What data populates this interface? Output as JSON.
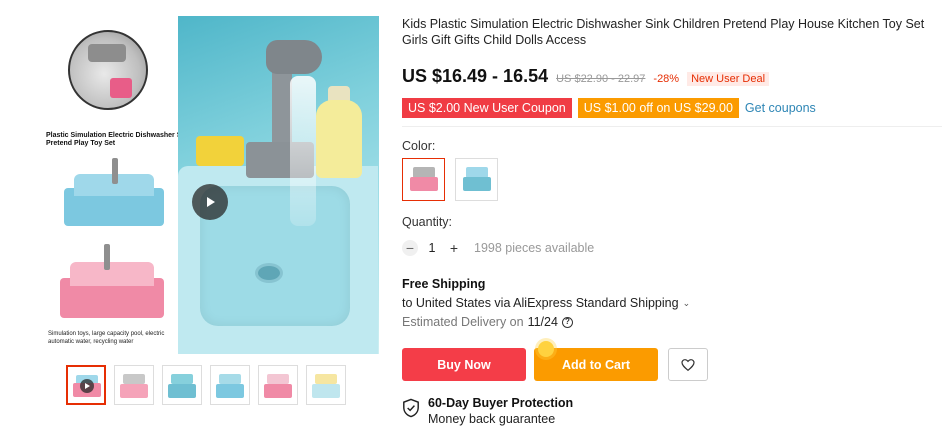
{
  "gallery": {
    "hero_title": "Plastic Simulation Electric Dishwasher Sink Pretend Play Toy Set",
    "hero_caption": "Simulation toys, large capacity pool, electric automatic water, recycling water",
    "thumbnail_count": 6
  },
  "product": {
    "title": "Kids Plastic Simulation Electric Dishwasher Sink Children Pretend Play House Kitchen Toy Set Girls Gift Gifts Child Dolls Access"
  },
  "price": {
    "current": "US $16.49 - 16.54",
    "original": "US $22.90 - 22.97",
    "discount": "-28%",
    "deal_badge": "New User Deal"
  },
  "coupons": {
    "new_user": "US $2.00 New User Coupon",
    "threshold": "US $1.00 off on US $29.00",
    "get_link": "Get coupons"
  },
  "color": {
    "label": "Color:",
    "options": [
      "pink",
      "blue"
    ],
    "selected": "pink"
  },
  "quantity": {
    "label": "Quantity:",
    "value": "1",
    "minus": "−",
    "plus": "+",
    "available": "1998 pieces available"
  },
  "shipping": {
    "title": "Free Shipping",
    "to": "to United States via AliExpress Standard Shipping",
    "delivery_label": "Estimated Delivery on",
    "delivery_date": "11/24"
  },
  "actions": {
    "buy_now": "Buy Now",
    "add_to_cart": "Add to Cart"
  },
  "protection": {
    "title": "60-Day Buyer Protection",
    "subtitle": "Money back guarantee"
  },
  "colors": {
    "price_red": "#e62e04",
    "buy_red": "#f43d48",
    "cart_orange": "#fb9b00",
    "coupon_red": "#f03c44",
    "link_blue": "#2e86b5"
  },
  "icons": [
    "play-icon",
    "chevron-down-icon",
    "help-icon",
    "heart-icon",
    "shield-check-icon"
  ]
}
